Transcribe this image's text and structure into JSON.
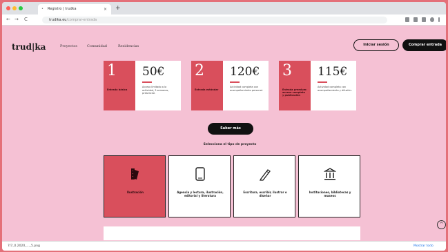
{
  "browser": {
    "tab_title": "Registro | trudka",
    "tab_favicon": "•",
    "close_glyph": "×",
    "newtab_glyph": "+",
    "nav_back": "←",
    "nav_forward": "→",
    "nav_reload": "C",
    "url_host": "trudika.eu",
    "url_path": "/comprar-entrada"
  },
  "site": {
    "logo": "trud|ka",
    "nav": [
      "Proyectos",
      "Comunidad",
      "Residencias"
    ],
    "login_label": "Iniciar sesión",
    "buy_label": "Comprar entrada"
  },
  "plans": [
    {
      "num": "1",
      "step_label": "Entrada básica",
      "price": "50€",
      "desc": "Acceso limitado a la actividad, 3 semanas, presencial."
    },
    {
      "num": "2",
      "step_label": "Entrada estándar",
      "price": "120€",
      "desc": "Actividad completa con acompañamiento personal."
    },
    {
      "num": "3",
      "step_label": "Entrada premium: acceso completo y publicación",
      "price": "115€",
      "desc": "Actividad completa con acompañamiento y difusión."
    }
  ],
  "info_button": "Saber más",
  "select_label": "Selecciona el tipo de proyecto",
  "types": [
    {
      "label": "Ilustración",
      "icon": "palette-icon"
    },
    {
      "label": "Agencia y lectura, ilustración, editorial y literatura",
      "icon": "document-icon"
    },
    {
      "label": "Escritura, escribir, ilustrar o diseñar",
      "icon": "pen-icon"
    },
    {
      "label": "Instituciones, bibliotecas y museos",
      "icon": "museum-icon"
    }
  ],
  "scroll_top_glyph": "^",
  "downloads": {
    "item": "7/7_0.2020_..._5.png",
    "show_all": "Mostrar todo"
  },
  "colors": {
    "accent": "#d94f5c",
    "page_bg": "#f5c1d4",
    "frame_bg": "#e47079"
  }
}
